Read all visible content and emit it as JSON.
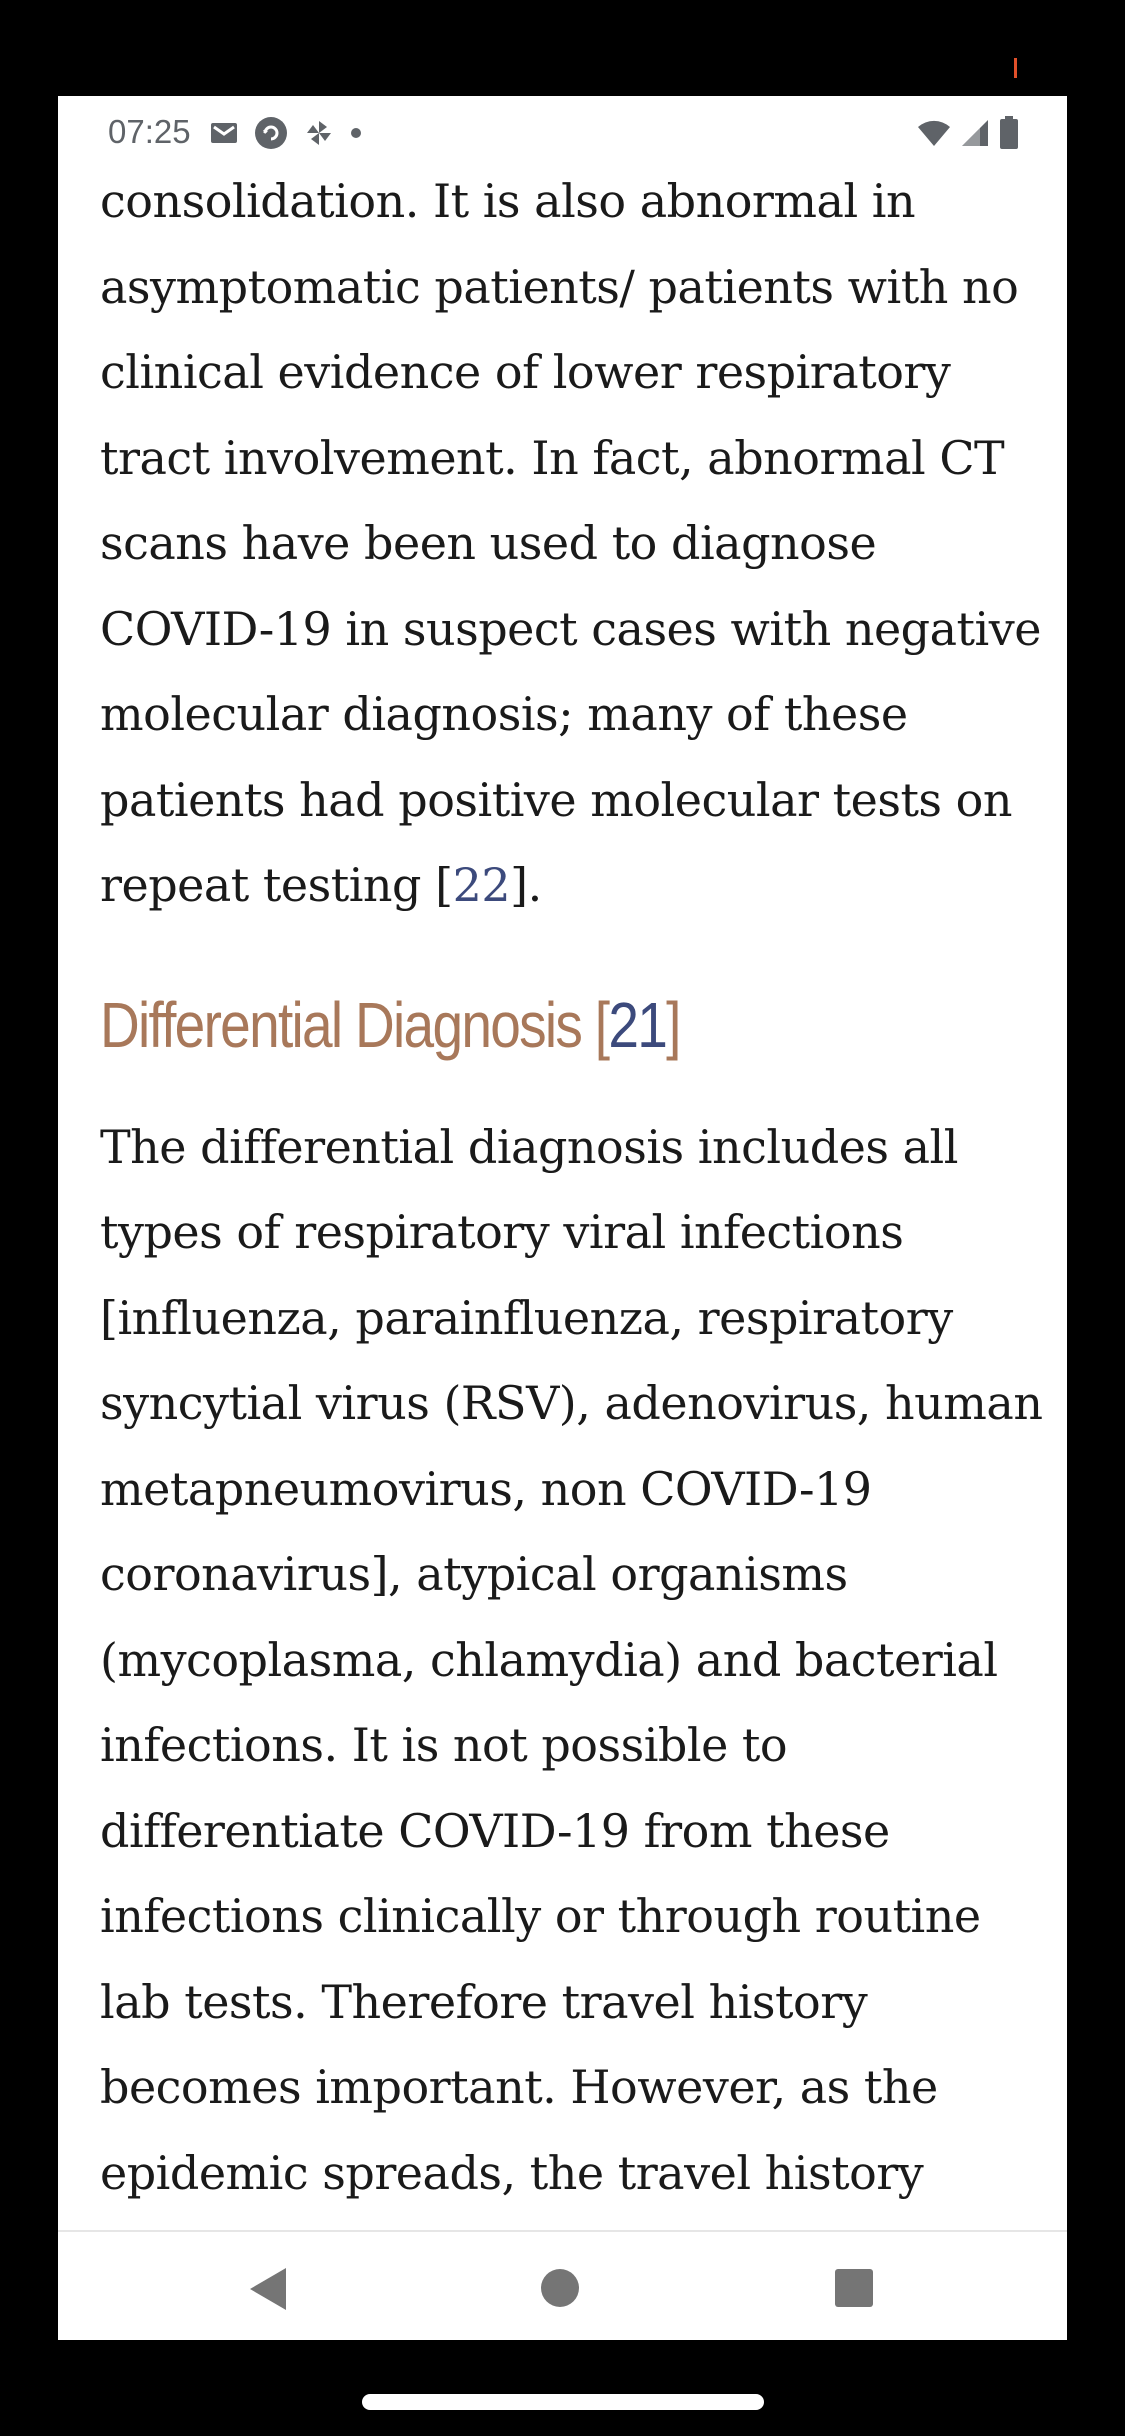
{
  "status_bar": {
    "time": "07:25",
    "left_icons": [
      "gmail-icon",
      "sync-circle-icon",
      "pinwheel-icon",
      "notification-dot-icon"
    ],
    "right_icons": [
      "wifi-icon",
      "cellular-signal-icon",
      "battery-icon"
    ]
  },
  "article": {
    "para1": "consolidation. It is also abnormal in asymptomatic patients/ patients with no clinical evidence of lower respiratory tract involvement. In fact, abnormal CT scans have been used to diagnose COVID-19 in suspect cases with negative molecular diagnosis; many of these patients had positive molecular tests on repeat testing [",
    "para1_cite": "22",
    "para1_end": "].",
    "heading_text": "Differential Diagnosis [",
    "heading_cite": "21",
    "heading_end": "]",
    "para2": "The differential diagnosis includes all types of respiratory viral infections [influenza, parainfluenza, respiratory syncytial virus (RSV), adenovirus, human metapneumovirus, non COVID-19 coronavirus], atypical organisms (mycoplasma, chlamydia) and bacterial infections. It is not possible to differentiate COVID-19 from these infections clinically or through routine lab tests. Therefore travel history becomes important. However, as the epidemic spreads, the travel history"
  },
  "colors": {
    "heading": "#a8785a",
    "citation_link": "#3c4a7c",
    "body_text": "#1a1a1a",
    "status_icons": "#5f6368",
    "nav_icons": "#757575"
  },
  "nav_bar": {
    "icons": [
      "back-triangle-icon",
      "home-circle-icon",
      "recents-square-icon"
    ]
  }
}
